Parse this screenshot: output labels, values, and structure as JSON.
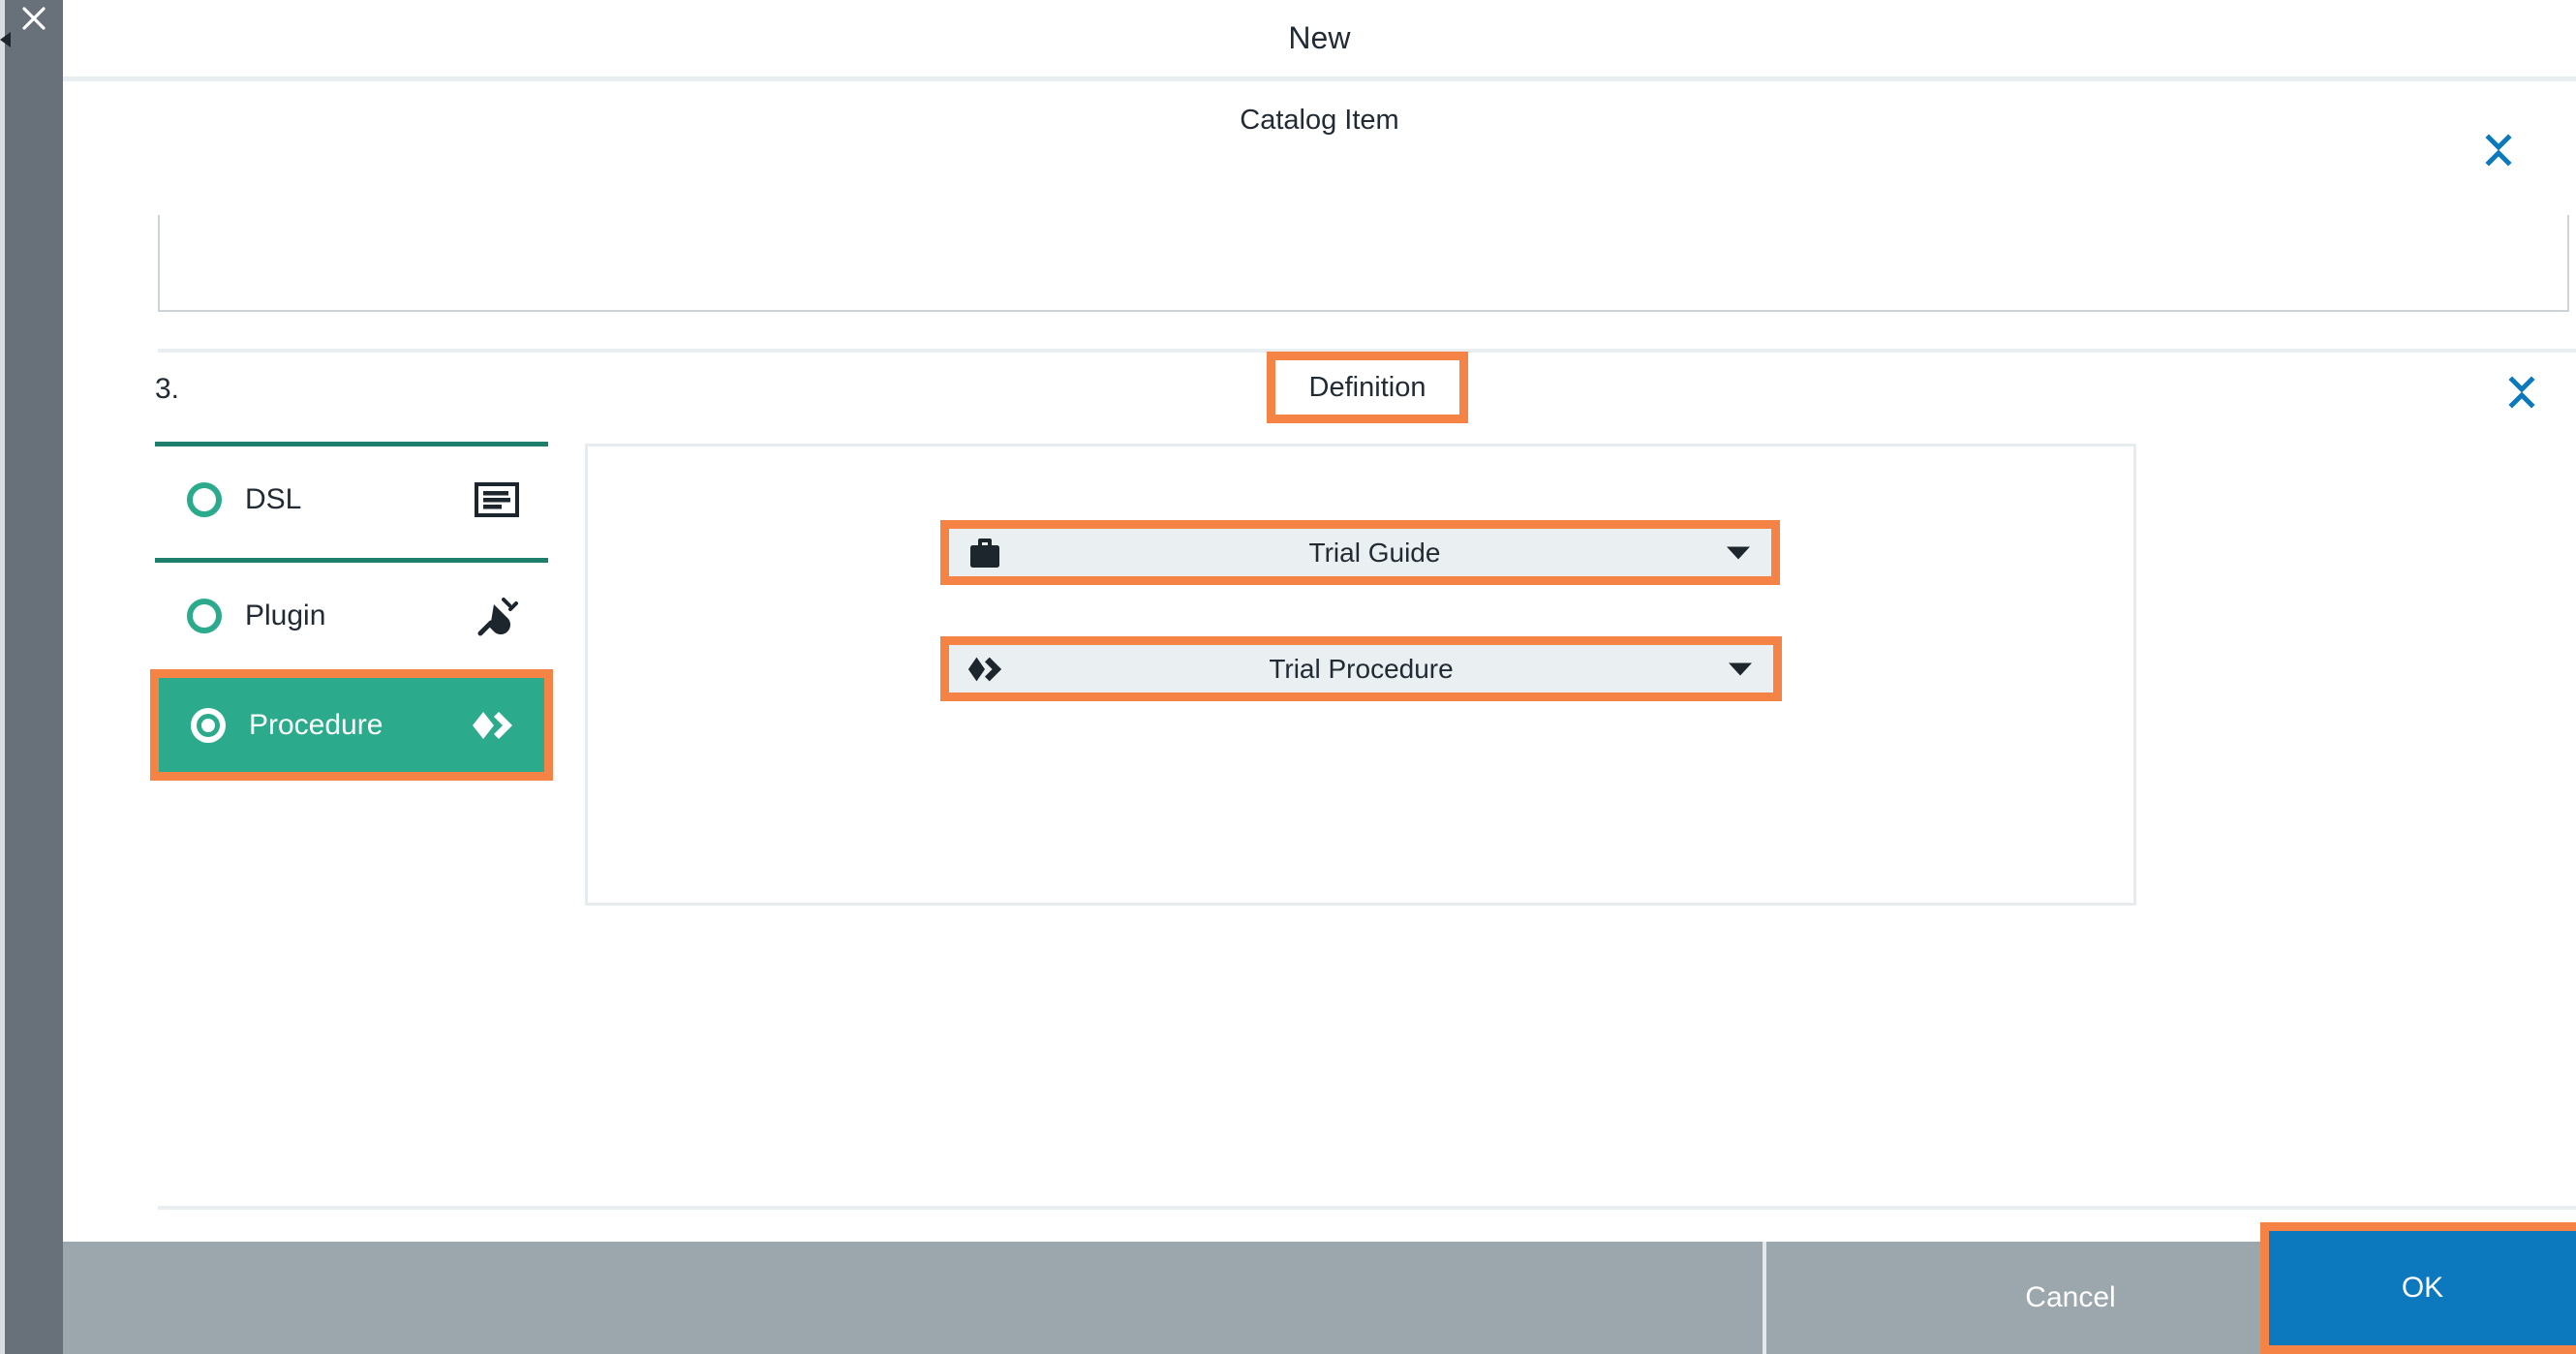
{
  "window": {
    "title": "New",
    "close_icon": "close-icon",
    "back_caret_icon": "caret-left-icon"
  },
  "sections": [
    {
      "id": "catalog-item",
      "title": "Catalog Item",
      "collapse_icon": "collapse-expand-icon"
    },
    {
      "id": "definition",
      "title": "Definition",
      "collapse_icon": "collapse-expand-icon",
      "highlighted": true
    }
  ],
  "step": {
    "number": "3."
  },
  "definition_options": [
    {
      "id": "dsl",
      "label": "DSL",
      "selected": false,
      "icon": "script-document-icon"
    },
    {
      "id": "plugin",
      "label": "Plugin",
      "selected": false,
      "icon": "plug-icon"
    },
    {
      "id": "procedure",
      "label": "Procedure",
      "selected": true,
      "icon": "code-chevrons-icon",
      "highlighted": true
    }
  ],
  "dropdowns": [
    {
      "id": "guide",
      "value": "Trial Guide",
      "icon": "briefcase-icon",
      "caret": "chevron-down-icon",
      "highlighted": true
    },
    {
      "id": "procedure",
      "value": "Trial Procedure",
      "icon": "code-chevrons-icon",
      "caret": "chevron-down-icon",
      "highlighted": true
    }
  ],
  "footer": {
    "cancel_label": "Cancel",
    "ok_label": "OK",
    "ok_highlighted": true
  },
  "colors": {
    "accent_green": "#2bab8b",
    "rule_green": "#1f7f6d",
    "highlight_orange": "#f58345",
    "primary_blue": "#0c78be",
    "link_blue": "#0c78be",
    "footer_gray": "#9ba6ad",
    "rail_gray": "#68707a",
    "field_gray": "#eaeff2",
    "text_dark": "#222b33"
  }
}
